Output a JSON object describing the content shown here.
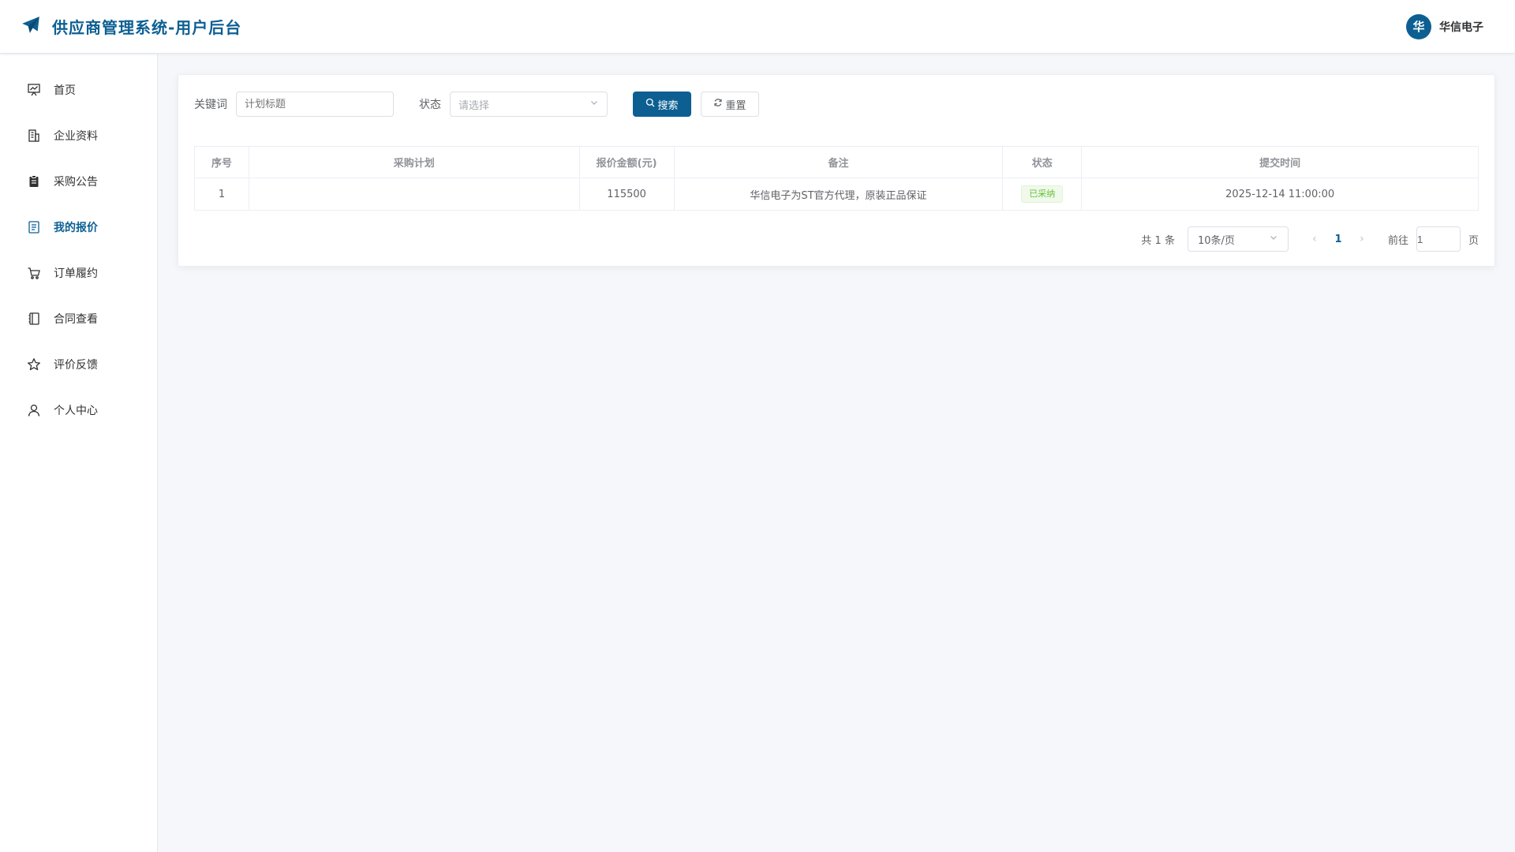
{
  "header": {
    "title": "供应商管理系统-用户后台",
    "user_avatar": "华",
    "user_name": "华信电子",
    "brand_color": "#0d5f92"
  },
  "sidebar": {
    "items": [
      {
        "label": "首页",
        "icon": "chart-board-icon"
      },
      {
        "label": "企业资料",
        "icon": "building-icon"
      },
      {
        "label": "采购公告",
        "icon": "clipboard-icon"
      },
      {
        "label": "我的报价",
        "icon": "document-icon",
        "active": true
      },
      {
        "label": "订单履约",
        "icon": "cart-icon"
      },
      {
        "label": "合同查看",
        "icon": "notebook-icon"
      },
      {
        "label": "评价反馈",
        "icon": "star-icon"
      },
      {
        "label": "个人中心",
        "icon": "user-icon"
      }
    ]
  },
  "search": {
    "keyword_label": "关键词",
    "keyword_placeholder": "计划标题",
    "status_label": "状态",
    "status_placeholder": "请选择",
    "search_button": "搜索",
    "reset_button": "重置"
  },
  "table": {
    "columns": [
      "序号",
      "采购计划",
      "报价金额(元)",
      "备注",
      "状态",
      "提交时间"
    ],
    "rows": [
      {
        "index": "1",
        "plan": "",
        "amount": "115500",
        "remark": "华信电子为ST官方代理，原装正品保证",
        "status": "已采纳",
        "time": "2025-12-14 11:00:00"
      }
    ]
  },
  "pagination": {
    "total": "共 1 条",
    "page_size": "10条/页",
    "current": "1",
    "goto_label": "前往",
    "goto_value": "1",
    "page_suffix": "页"
  }
}
